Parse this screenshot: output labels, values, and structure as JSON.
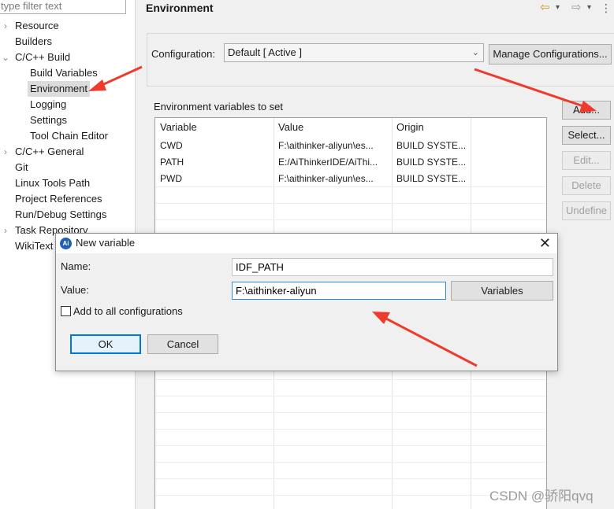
{
  "filter": {
    "placeholder": "type filter text"
  },
  "tree": {
    "items": [
      {
        "label": "Resource",
        "arrow": "›"
      },
      {
        "label": "Builders",
        "arrow": ""
      },
      {
        "label": "C/C++ Build",
        "arrow": "⌄"
      },
      {
        "label": "Build Variables",
        "arrow": ""
      },
      {
        "label": "Environment",
        "arrow": ""
      },
      {
        "label": "Logging",
        "arrow": ""
      },
      {
        "label": "Settings",
        "arrow": ""
      },
      {
        "label": "Tool Chain Editor",
        "arrow": ""
      },
      {
        "label": "C/C++ General",
        "arrow": "›"
      },
      {
        "label": "Git",
        "arrow": ""
      },
      {
        "label": "Linux Tools Path",
        "arrow": ""
      },
      {
        "label": "Project References",
        "arrow": ""
      },
      {
        "label": "Run/Debug Settings",
        "arrow": ""
      },
      {
        "label": "Task Repository",
        "arrow": "›"
      },
      {
        "label": "WikiText",
        "arrow": ""
      }
    ]
  },
  "header": {
    "title": "Environment",
    "back_icon": "⇦",
    "forward_icon": "⇨",
    "dropdown_icon": "▾",
    "menu_icon": "⋮"
  },
  "config": {
    "label": "Configuration:",
    "selected": "Default  [ Active ]",
    "chevron": "⌄",
    "manage_label": "Manage Configurations..."
  },
  "env": {
    "label": "Environment variables to set",
    "columns": [
      "Variable",
      "Value",
      "Origin"
    ],
    "rows": [
      {
        "variable": "CWD",
        "value": "F:\\aithinker-aliyun\\es...",
        "origin": "BUILD SYSTE..."
      },
      {
        "variable": "PATH",
        "value": "E:/AiThinkerIDE/AiThi...",
        "origin": "BUILD SYSTE..."
      },
      {
        "variable": "PWD",
        "value": "F:\\aithinker-aliyun\\es...",
        "origin": "BUILD SYSTE..."
      }
    ]
  },
  "side_buttons": {
    "add": "Add...",
    "select": "Select...",
    "edit": "Edit...",
    "delete": "Delete",
    "undefine": "Undefine"
  },
  "dialog": {
    "title": "New variable",
    "icon_text": "Ai",
    "close_icon": "✕",
    "name_label": "Name:",
    "name_value": "IDF_PATH",
    "value_label": "Value:",
    "value_value": "F:\\aithinker-aliyun",
    "variables_label": "Variables",
    "add_all_label": "Add to all configurations",
    "add_all_checked": false,
    "ok_label": "OK",
    "cancel_label": "Cancel"
  },
  "watermark": "CSDN @骄阳qvq",
  "colors": {
    "annotation_arrow": "#ef3b2c",
    "accent": "#0078d7"
  }
}
